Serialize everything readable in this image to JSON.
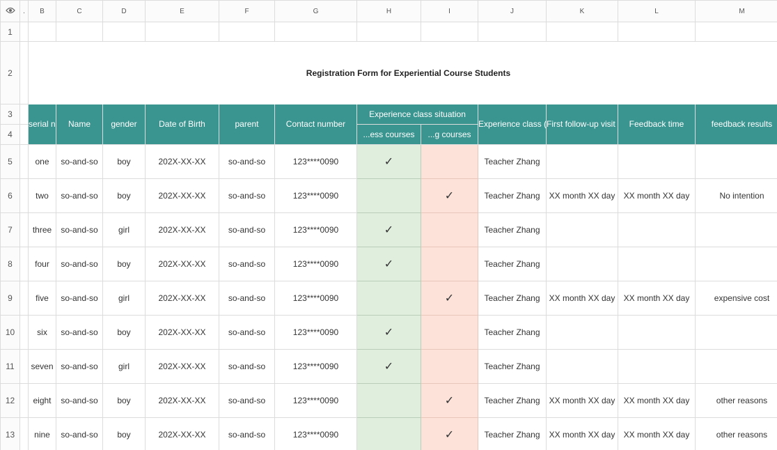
{
  "columns": [
    "B",
    "C",
    "D",
    "E",
    "F",
    "G",
    "H",
    "I",
    "J",
    "K",
    "L",
    "M"
  ],
  "row_numbers": [
    "1",
    "2",
    "3",
    "4",
    "5",
    "6",
    "7",
    "8",
    "9",
    "10",
    "11",
    "12",
    "13"
  ],
  "title": "Registration Form for Experiential Course Students",
  "headers": {
    "serial": "serial num ber",
    "name": "Name",
    "gender": "gender",
    "dob": "Date of Birth",
    "parent": "parent",
    "contact": "Contact number",
    "experience": "Experience class situation",
    "exp_sub1": "...ess courses",
    "exp_sub2": "...g courses",
    "teacher": "Experience class (follow-up) teacher",
    "followup": "First follow-up visit time",
    "feedback_time": "Feedback time",
    "feedback_results": "feedback results"
  },
  "check_symbol": "✓",
  "rows": [
    {
      "serial": "one",
      "name": "so-and-so",
      "gender": "boy",
      "dob": "202X-XX-XX",
      "parent": "so-and-so",
      "contact": "123****0090",
      "h": "✓",
      "i": "",
      "teacher": "Teacher Zhang",
      "followup": "",
      "feedback_time": "",
      "feedback_results": ""
    },
    {
      "serial": "two",
      "name": "so-and-so",
      "gender": "boy",
      "dob": "202X-XX-XX",
      "parent": "so-and-so",
      "contact": "123****0090",
      "h": "",
      "i": "✓",
      "teacher": "Teacher Zhang",
      "followup": "XX month XX day",
      "feedback_time": "XX month XX day",
      "feedback_results": "No intention"
    },
    {
      "serial": "three",
      "name": "so-and-so",
      "gender": "girl",
      "dob": "202X-XX-XX",
      "parent": "so-and-so",
      "contact": "123****0090",
      "h": "✓",
      "i": "",
      "teacher": "Teacher Zhang",
      "followup": "",
      "feedback_time": "",
      "feedback_results": ""
    },
    {
      "serial": "four",
      "name": "so-and-so",
      "gender": "boy",
      "dob": "202X-XX-XX",
      "parent": "so-and-so",
      "contact": "123****0090",
      "h": "✓",
      "i": "",
      "teacher": "Teacher Zhang",
      "followup": "",
      "feedback_time": "",
      "feedback_results": ""
    },
    {
      "serial": "five",
      "name": "so-and-so",
      "gender": "girl",
      "dob": "202X-XX-XX",
      "parent": "so-and-so",
      "contact": "123****0090",
      "h": "",
      "i": "✓",
      "teacher": "Teacher Zhang",
      "followup": "XX month XX day",
      "feedback_time": "XX month XX day",
      "feedback_results": "expensive cost"
    },
    {
      "serial": "six",
      "name": "so-and-so",
      "gender": "boy",
      "dob": "202X-XX-XX",
      "parent": "so-and-so",
      "contact": "123****0090",
      "h": "✓",
      "i": "",
      "teacher": "Teacher Zhang",
      "followup": "",
      "feedback_time": "",
      "feedback_results": ""
    },
    {
      "serial": "seven",
      "name": "so-and-so",
      "gender": "girl",
      "dob": "202X-XX-XX",
      "parent": "so-and-so",
      "contact": "123****0090",
      "h": "✓",
      "i": "",
      "teacher": "Teacher Zhang",
      "followup": "",
      "feedback_time": "",
      "feedback_results": ""
    },
    {
      "serial": "eight",
      "name": "so-and-so",
      "gender": "boy",
      "dob": "202X-XX-XX",
      "parent": "so-and-so",
      "contact": "123****0090",
      "h": "",
      "i": "✓",
      "teacher": "Teacher Zhang",
      "followup": "XX month XX day",
      "feedback_time": "XX month XX day",
      "feedback_results": "other reasons"
    },
    {
      "serial": "nine",
      "name": "so-and-so",
      "gender": "boy",
      "dob": "202X-XX-XX",
      "parent": "so-and-so",
      "contact": "123****0090",
      "h": "",
      "i": "✓",
      "teacher": "Teacher Zhang",
      "followup": "XX month XX day",
      "feedback_time": "XX month XX day",
      "feedback_results": "other reasons"
    }
  ],
  "colors": {
    "header_teal": "#3a9590",
    "green_fill": "#dfeedd",
    "pink_fill": "#fce2d9"
  },
  "icons": {
    "corner": "eye-icon"
  }
}
